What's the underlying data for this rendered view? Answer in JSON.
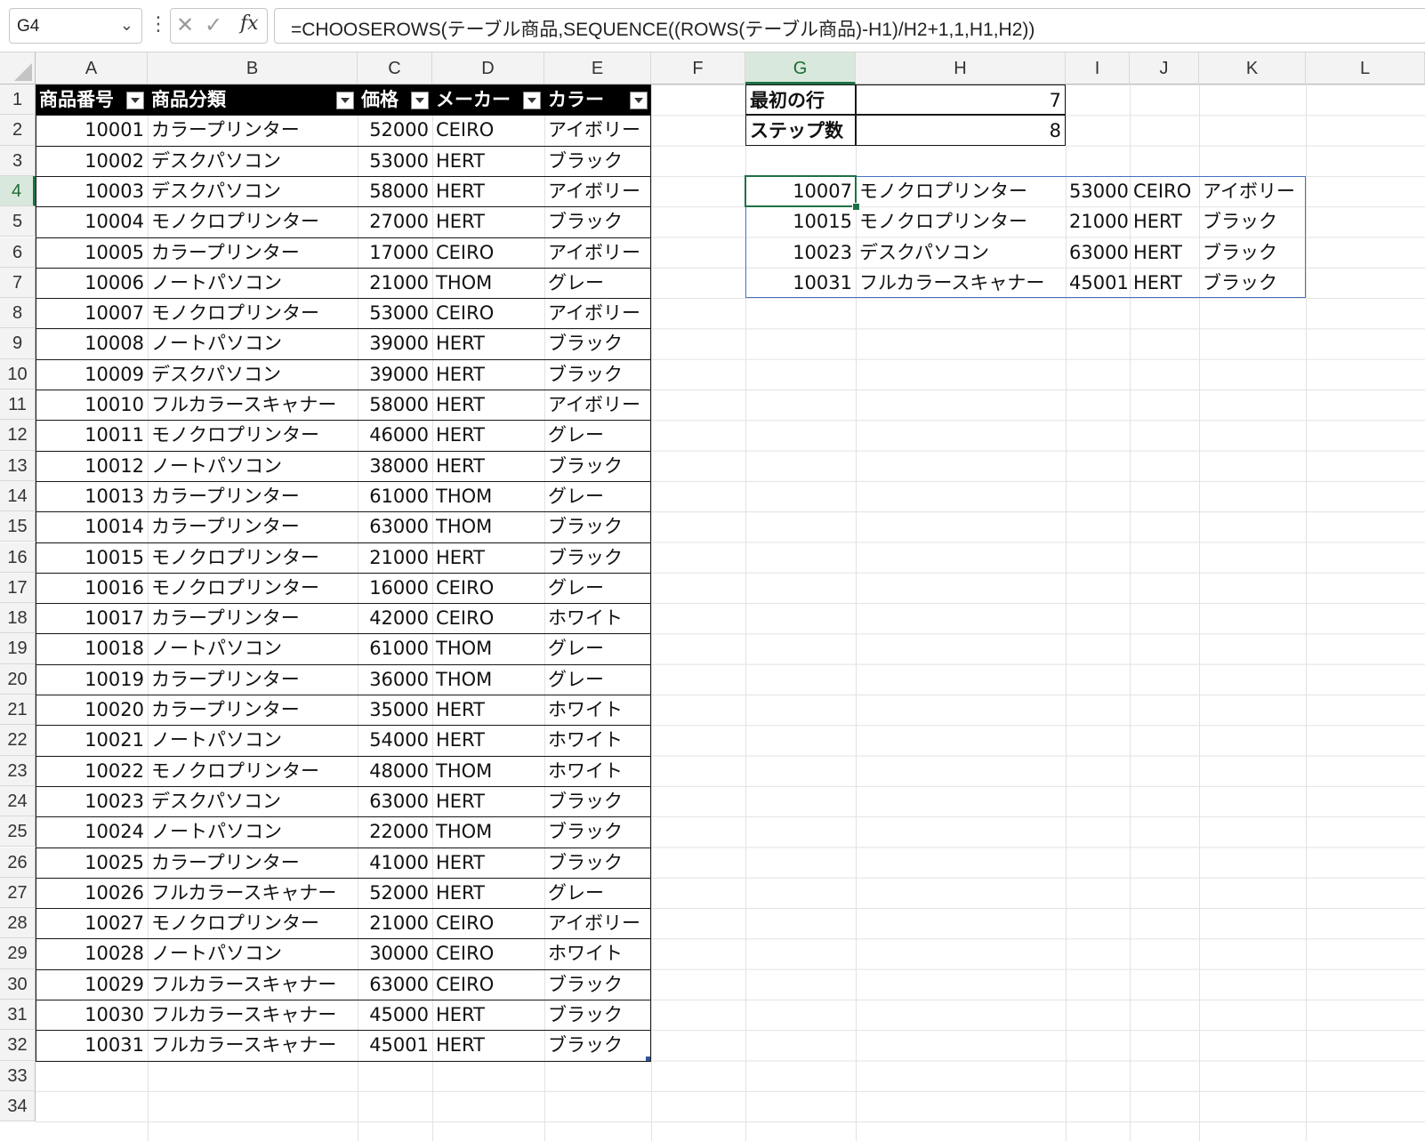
{
  "name_box": {
    "value": "G4"
  },
  "formula_bar": {
    "cancel_glyph": "✕",
    "enter_glyph": "✓",
    "fx_label": "fx",
    "formula": "=CHOOSEROWS(テーブル商品,SEQUENCE((ROWS(テーブル商品)-H1)/H2+1,1,H1,H2))"
  },
  "columns": [
    "A",
    "B",
    "C",
    "D",
    "E",
    "F",
    "G",
    "H",
    "I",
    "J",
    "K",
    "L"
  ],
  "selected_column": "G",
  "selected_row": 4,
  "row_numbers": [
    1,
    2,
    3,
    4,
    5,
    6,
    7,
    8,
    9,
    10,
    11,
    12,
    13,
    14,
    15,
    16,
    17,
    18,
    19,
    20,
    21,
    22,
    23,
    24,
    25,
    26,
    27,
    28,
    29,
    30,
    31,
    32,
    33,
    34
  ],
  "table": {
    "headers": [
      "商品番号",
      "商品分類",
      "価格",
      "メーカー",
      "カラー"
    ],
    "rows": [
      [
        "10001",
        "カラープリンター",
        "52000",
        "CEIRO",
        "アイボリー"
      ],
      [
        "10002",
        "デスクパソコン",
        "53000",
        "HERT",
        "ブラック"
      ],
      [
        "10003",
        "デスクパソコン",
        "58000",
        "HERT",
        "アイボリー"
      ],
      [
        "10004",
        "モノクロプリンター",
        "27000",
        "HERT",
        "ブラック"
      ],
      [
        "10005",
        "カラープリンター",
        "17000",
        "CEIRO",
        "アイボリー"
      ],
      [
        "10006",
        "ノートパソコン",
        "21000",
        "THOM",
        "グレー"
      ],
      [
        "10007",
        "モノクロプリンター",
        "53000",
        "CEIRO",
        "アイボリー"
      ],
      [
        "10008",
        "ノートパソコン",
        "39000",
        "HERT",
        "ブラック"
      ],
      [
        "10009",
        "デスクパソコン",
        "39000",
        "HERT",
        "ブラック"
      ],
      [
        "10010",
        "フルカラースキャナー",
        "58000",
        "HERT",
        "アイボリー"
      ],
      [
        "10011",
        "モノクロプリンター",
        "46000",
        "HERT",
        "グレー"
      ],
      [
        "10012",
        "ノートパソコン",
        "38000",
        "HERT",
        "ブラック"
      ],
      [
        "10013",
        "カラープリンター",
        "61000",
        "THOM",
        "グレー"
      ],
      [
        "10014",
        "カラープリンター",
        "63000",
        "THOM",
        "ブラック"
      ],
      [
        "10015",
        "モノクロプリンター",
        "21000",
        "HERT",
        "ブラック"
      ],
      [
        "10016",
        "モノクロプリンター",
        "16000",
        "CEIRO",
        "グレー"
      ],
      [
        "10017",
        "カラープリンター",
        "42000",
        "CEIRO",
        "ホワイト"
      ],
      [
        "10018",
        "ノートパソコン",
        "61000",
        "THOM",
        "グレー"
      ],
      [
        "10019",
        "カラープリンター",
        "36000",
        "THOM",
        "グレー"
      ],
      [
        "10020",
        "カラープリンター",
        "35000",
        "HERT",
        "ホワイト"
      ],
      [
        "10021",
        "ノートパソコン",
        "54000",
        "HERT",
        "ホワイト"
      ],
      [
        "10022",
        "モノクロプリンター",
        "48000",
        "THOM",
        "ホワイト"
      ],
      [
        "10023",
        "デスクパソコン",
        "63000",
        "HERT",
        "ブラック"
      ],
      [
        "10024",
        "ノートパソコン",
        "22000",
        "THOM",
        "ブラック"
      ],
      [
        "10025",
        "カラープリンター",
        "41000",
        "HERT",
        "ブラック"
      ],
      [
        "10026",
        "フルカラースキャナー",
        "52000",
        "HERT",
        "グレー"
      ],
      [
        "10027",
        "モノクロプリンター",
        "21000",
        "CEIRO",
        "アイボリー"
      ],
      [
        "10028",
        "ノートパソコン",
        "30000",
        "CEIRO",
        "ホワイト"
      ],
      [
        "10029",
        "フルカラースキャナー",
        "63000",
        "CEIRO",
        "ブラック"
      ],
      [
        "10030",
        "フルカラースキャナー",
        "45000",
        "HERT",
        "ブラック"
      ],
      [
        "10031",
        "フルカラースキャナー",
        "45001",
        "HERT",
        "ブラック"
      ]
    ]
  },
  "params": [
    {
      "label": "最初の行",
      "value": "7"
    },
    {
      "label": "ステップ数",
      "value": "8"
    }
  ],
  "results": [
    [
      "10007",
      "モノクロプリンター",
      "53000",
      "CEIRO",
      "アイボリー"
    ],
    [
      "10015",
      "モノクロプリンター",
      "21000",
      "HERT",
      "ブラック"
    ],
    [
      "10023",
      "デスクパソコン",
      "63000",
      "HERT",
      "ブラック"
    ],
    [
      "10031",
      "フルカラースキャナー",
      "45001",
      "HERT",
      "ブラック"
    ]
  ],
  "colors": {
    "selection_green": "#1e7145",
    "spill_blue": "#4472c4",
    "table_header_bg": "#000000"
  },
  "icons": {
    "namebox_dropdown": "chevron-down-icon",
    "more": "vertical-ellipsis-icon",
    "cancel": "x-icon",
    "enter": "check-icon",
    "function": "fx-icon",
    "filter": "filter-dropdown-icon"
  }
}
